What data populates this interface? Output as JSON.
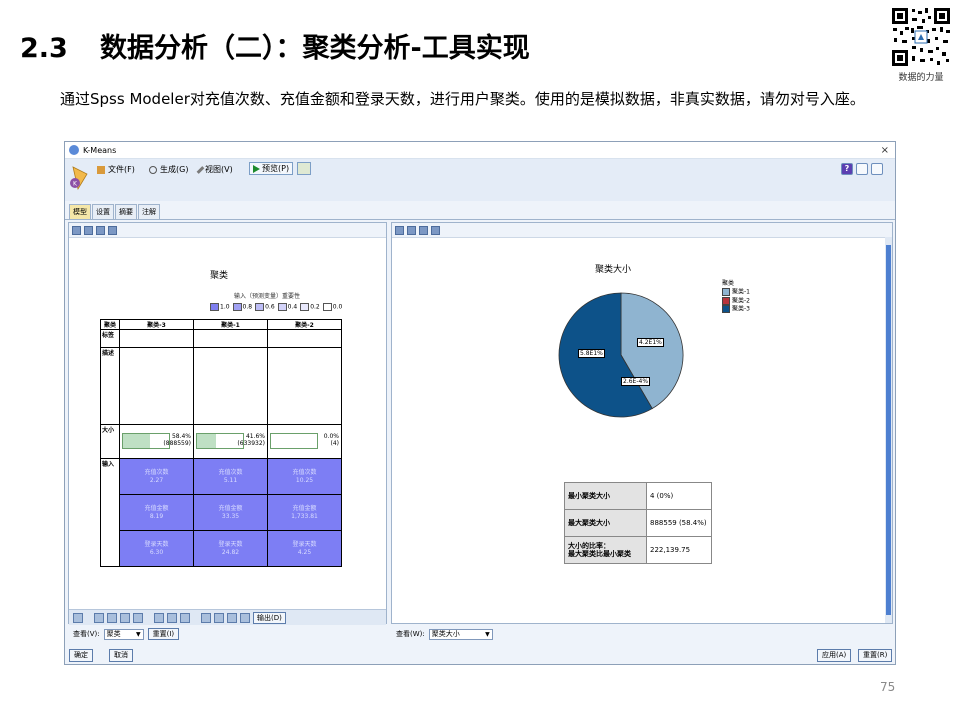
{
  "slide": {
    "number": "2.3",
    "title": "数据分析（二）：聚类分析-工具实现",
    "subtitle": "通过Spss Modeler对充值次数、充值金额和登录天数，进行用户聚类。使用的是模拟数据，非真实数据，请勿对号入座。",
    "qr_caption": "数据的力量",
    "page_number": "75"
  },
  "window": {
    "title": "K-Means",
    "close_glyph": "×",
    "menu": [
      {
        "label": "文件(F)",
        "icon": "file-icon"
      },
      {
        "label": "生成(G)",
        "icon": "generate-icon"
      },
      {
        "label": "视图(V)",
        "icon": "view-icon"
      }
    ],
    "preview_label": "预览(P)",
    "help_glyph": "?",
    "tabs": [
      "模型",
      "设置",
      "摘要",
      "注解"
    ],
    "footer": {
      "ok": "确定",
      "cancel": "取消",
      "apply": "应用(A)",
      "reset": "重置(R)"
    }
  },
  "left_pane": {
    "title": "聚类",
    "importance_note": "输入（预测变量）重要性",
    "importance_legend": [
      "1.0",
      "0.8",
      "0.6",
      "0.4",
      "0.2",
      "0.0"
    ],
    "importance_colors": [
      "#7f7ff0",
      "#a1a1f3",
      "#bdbdf6",
      "#d3d3f9",
      "#e8e8fc",
      "#ffffff"
    ],
    "table": {
      "corner": "聚类",
      "clusters": [
        "聚类-3",
        "聚类-1",
        "聚类-2"
      ],
      "row_labels": {
        "label": "标签",
        "description": "描述",
        "size": "大小",
        "inputs": "输入"
      },
      "sizes": [
        {
          "pct_text": "58.4%",
          "count": "(888559)",
          "fraction": 0.584
        },
        {
          "pct_text": "41.6%",
          "count": "(633932)",
          "fraction": 0.416
        },
        {
          "pct_text": "0.0%",
          "count": "(4)",
          "fraction": 0.0
        }
      ],
      "input_rows": [
        {
          "name": "充值次数",
          "values": [
            "2.27",
            "5.11",
            "10.25"
          ]
        },
        {
          "name": "充值金额",
          "values": [
            "8.19",
            "33.35",
            "1,733.81"
          ]
        },
        {
          "name": "登录天数",
          "values": [
            "6.30",
            "24.82",
            "4.25"
          ]
        }
      ]
    },
    "export_label": "输出(D)",
    "view_label": "查看(V):",
    "view_value": "聚类",
    "reset_label": "重置(I)"
  },
  "right_pane": {
    "chart_data": {
      "type": "pie",
      "title": "聚类大小",
      "legend_title": "聚类",
      "slices": [
        {
          "name": "聚类-1",
          "value": 41.6,
          "label": "4.2E1%",
          "color": "#8fb4d0"
        },
        {
          "name": "聚类-2",
          "value": 0.00026,
          "label": "2.6E-4%",
          "color": "#b8343c"
        },
        {
          "name": "聚类-3",
          "value": 58.4,
          "label": "5.8E1%",
          "color": "#0d5289"
        }
      ],
      "legend_placement": "right"
    },
    "summary": [
      {
        "label": "最小聚类大小",
        "value": "4 (0%)"
      },
      {
        "label": "最大聚类大小",
        "value": "888559 (58.4%)"
      },
      {
        "label": "大小的比率：\n最大聚类比最小聚类",
        "value": "222,139.75"
      }
    ],
    "view_label": "查看(W):",
    "view_value": "聚类大小"
  }
}
